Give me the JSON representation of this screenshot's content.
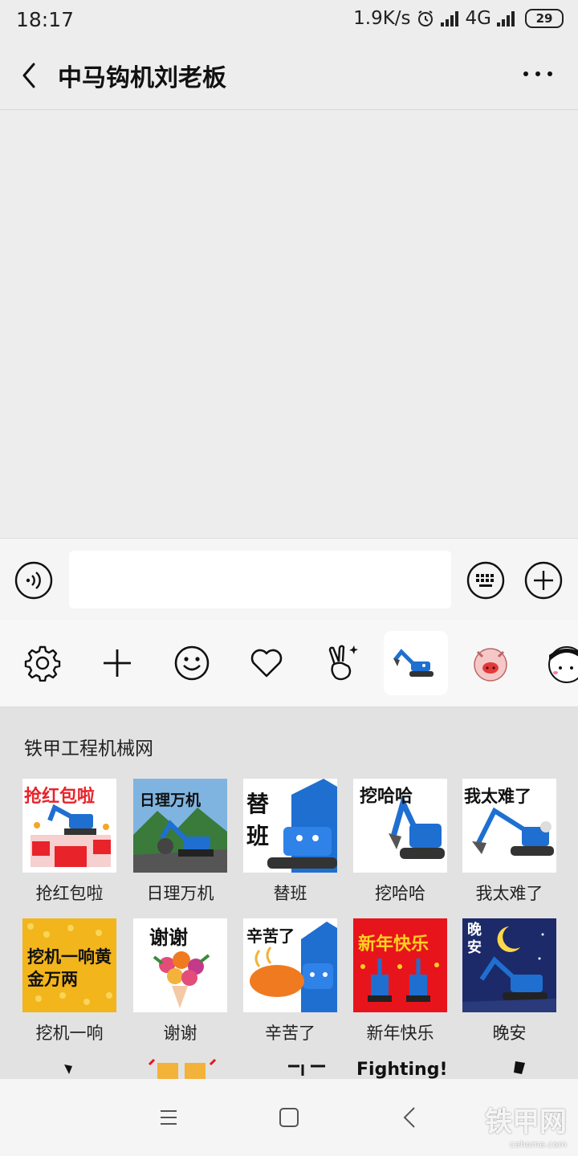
{
  "status_bar": {
    "time": "18:17",
    "network_speed": "1.9K/s",
    "network_type": "4G",
    "battery": "29"
  },
  "header": {
    "title": "中马钩机刘老板"
  },
  "input": {
    "value": "",
    "placeholder": ""
  },
  "emoji_tabs": [
    {
      "icon": "gear-icon"
    },
    {
      "icon": "plus-icon"
    },
    {
      "icon": "smiley-icon"
    },
    {
      "icon": "heart-icon"
    },
    {
      "icon": "victory-hand-icon"
    },
    {
      "icon": "excavator-sticker-pack-icon",
      "active": true
    },
    {
      "icon": "pig-sticker-pack-icon"
    },
    {
      "icon": "cartoon-girl-sticker-pack-icon"
    }
  ],
  "sticker_panel": {
    "pack_name": "铁甲工程机械网",
    "stickers": [
      {
        "label": "抢红包啦",
        "caption": "抢红包啦",
        "bg": "#ffffff",
        "accent": "#e8232a"
      },
      {
        "label": "日理万机",
        "caption": "日理万机",
        "bg": "#4a90c8",
        "accent": "#3a7a3a"
      },
      {
        "label": "替班",
        "caption": "替班",
        "bg": "#ffffff",
        "accent": "#1f6fd1"
      },
      {
        "label": "挖哈哈",
        "caption": "挖哈哈",
        "bg": "#ffffff",
        "accent": "#1f6fd1"
      },
      {
        "label": "我太难了",
        "caption": "我太难了",
        "bg": "#ffffff",
        "accent": "#1f6fd1"
      },
      {
        "label": "挖机一响",
        "caption": "挖机一响黄金万两",
        "bg": "#f2b51c",
        "accent": "#111111"
      },
      {
        "label": "谢谢",
        "caption": "谢谢",
        "bg": "#ffffff",
        "accent": "#e24d7a"
      },
      {
        "label": "辛苦了",
        "caption": "辛苦了",
        "bg": "#ffffff",
        "accent": "#f07a20"
      },
      {
        "label": "新年快乐",
        "caption": "新年快乐",
        "bg": "#e8141c",
        "accent": "#ffd21f"
      },
      {
        "label": "晚安",
        "caption": "晚安",
        "bg": "#1c2a6a",
        "accent": "#ffd84a"
      }
    ],
    "partial_row_captions": [
      "Fighting!"
    ]
  },
  "watermark": {
    "text": "铁甲网",
    "sub": "cehome.com"
  },
  "colors": {
    "background": "#ededed",
    "panel": "#e2e2e2",
    "excavator_blue": "#1f6fd1"
  }
}
